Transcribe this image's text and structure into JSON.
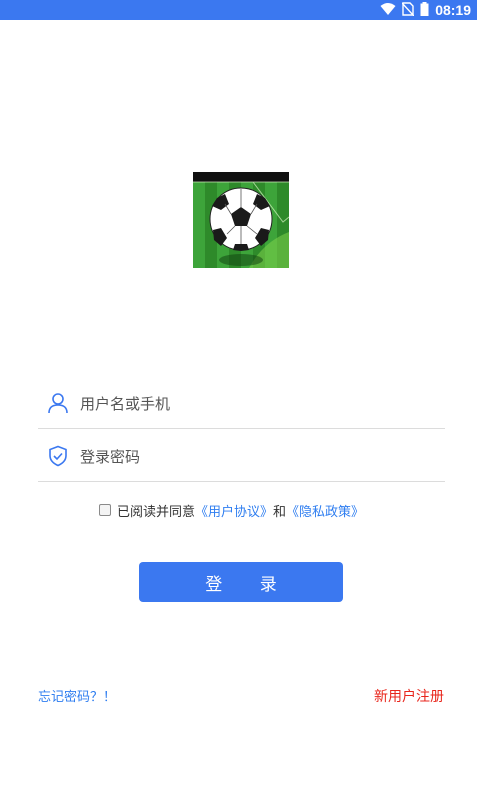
{
  "status_bar": {
    "time": "08:19",
    "icons": [
      "wifi-icon",
      "no-sim-icon",
      "battery-icon"
    ]
  },
  "logo": {
    "icon": "soccer-ball-logo"
  },
  "login_form": {
    "username": {
      "placeholder": "用户名或手机",
      "value": "",
      "icon": "user-icon"
    },
    "password": {
      "placeholder": "登录密码",
      "value": "",
      "icon": "shield-check-icon"
    },
    "agreement": {
      "checked": false,
      "prefix": "已阅读并同意",
      "user_agreement": "《用户协议》",
      "and": "和",
      "privacy_policy": "《隐私政策》"
    },
    "login_label": "登 录"
  },
  "footer": {
    "forgot_label": "忘记密码？！",
    "register_label": "新用户注册"
  },
  "colors": {
    "primary": "#3b78f0",
    "link": "#2f7ef0",
    "register": "#e8261c"
  }
}
